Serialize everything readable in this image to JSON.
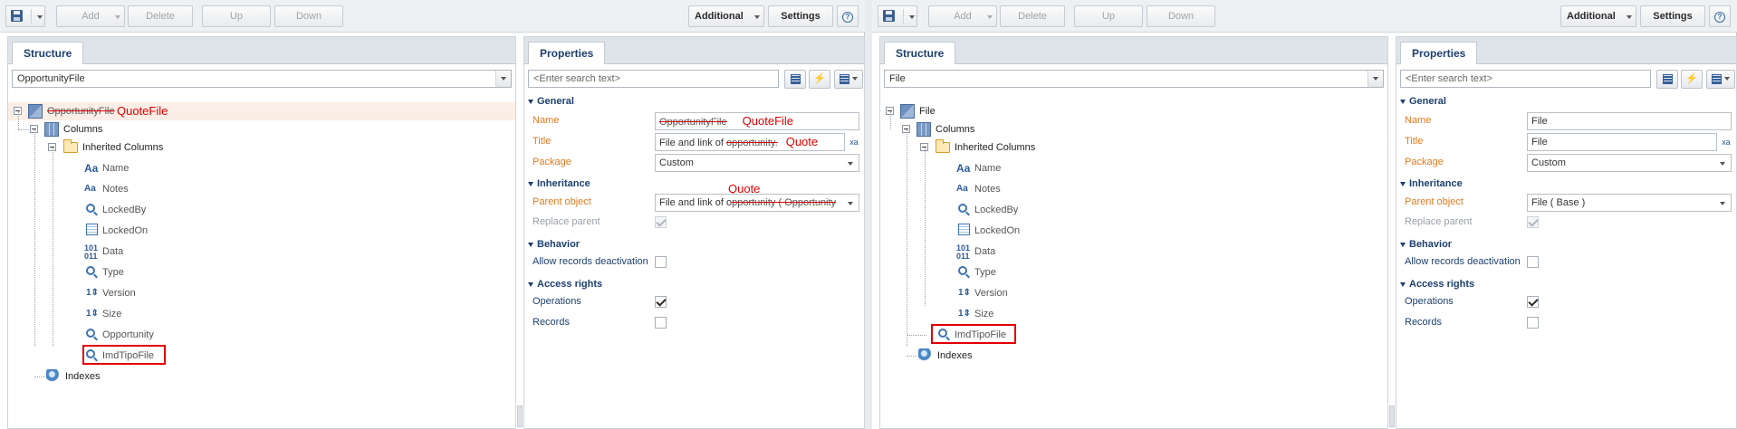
{
  "toolbar": {
    "add": "Add",
    "delete": "Delete",
    "up": "Up",
    "down": "Down",
    "additional": "Additional",
    "settings": "Settings"
  },
  "left": {
    "structure_tab": "Structure",
    "object_select": "OpportunityFile",
    "tree": {
      "root": "OpportunityFile",
      "root_annotation": "QuoteFile",
      "columns": "Columns",
      "inherited": "Inherited Columns",
      "items": [
        "Name",
        "Notes",
        "LockedBy",
        "LockedOn",
        "Data",
        "Type",
        "Version",
        "Size",
        "Opportunity",
        "ImdTipoFile"
      ],
      "indexes": "Indexes"
    },
    "properties": {
      "tab": "Properties",
      "search_placeholder": "<Enter search text>",
      "general": "General",
      "name_label": "Name",
      "name_value": "OpportunityFile",
      "name_annotation": "QuoteFile",
      "title_label": "Title",
      "title_value_prefix": "File and link of ",
      "title_value_struck": "opportunity.",
      "title_annotation": "Quote",
      "package_label": "Package",
      "package_value": "Custom",
      "inheritance": "Inheritance",
      "parent_label": "Parent object",
      "parent_value_prefix": "File and link of o",
      "parent_value_struck": "pportunity ( Opportunity",
      "parent_annotation": "Quote",
      "replace_label": "Replace parent",
      "behavior": "Behavior",
      "deactivation_label": "Allow records deactivation",
      "access": "Access rights",
      "operations_label": "Operations",
      "records_label": "Records"
    }
  },
  "right": {
    "structure_tab": "Structure",
    "object_select": "File",
    "tree": {
      "root": "File",
      "columns": "Columns",
      "inherited": "Inherited Columns",
      "items": [
        "Name",
        "Notes",
        "LockedBy",
        "LockedOn",
        "Data",
        "Type",
        "Version",
        "Size"
      ],
      "extra": "ImdTipoFile",
      "indexes": "Indexes"
    },
    "properties": {
      "tab": "Properties",
      "search_placeholder": "<Enter search text>",
      "general": "General",
      "name_label": "Name",
      "name_value": "File",
      "title_label": "Title",
      "title_value": "File",
      "package_label": "Package",
      "package_value": "Custom",
      "inheritance": "Inheritance",
      "parent_label": "Parent object",
      "parent_value": "File ( Base )",
      "replace_label": "Replace parent",
      "behavior": "Behavior",
      "deactivation_label": "Allow records deactivation",
      "access": "Access rights",
      "operations_label": "Operations",
      "records_label": "Records"
    }
  },
  "colors": {
    "accent": "#1d3f6e",
    "annotation": "#e00000",
    "label_orange": "#e07a1f",
    "selected_row": "#fbeee6"
  }
}
